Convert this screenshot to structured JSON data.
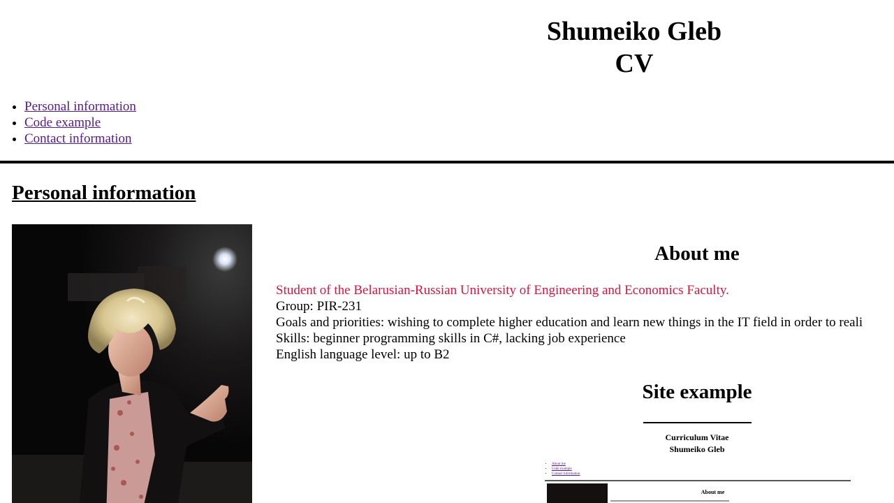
{
  "header": {
    "title_line1": "Shumeiko Gleb",
    "title_line2": "CV"
  },
  "nav": {
    "items": [
      {
        "label": "Personal information"
      },
      {
        "label": "Code example"
      },
      {
        "label": "Contact information"
      }
    ]
  },
  "personal": {
    "section_title": "Personal information",
    "about_heading": "About me",
    "about_lines": [
      "Student of the Belarusian-Russian University of Engineering and Economics Faculty.",
      "Group: PIR-231",
      "Goals and priorities: wishing to complete higher education and learn new things in the IT field in order to reali",
      "Skills: beginner programming skills in C#, lacking job experience",
      "English language level: up to B2"
    ],
    "site_example_heading": "Site example"
  },
  "mini_preview": {
    "title_line1": "Curriculum Vitae",
    "title_line2": "Shumeiko Gleb",
    "nav_items": [
      "About me",
      "Code example",
      "Contact information"
    ],
    "about_heading": "About me"
  },
  "colors": {
    "link": "#551a8b",
    "highlight": "#dc143c"
  }
}
